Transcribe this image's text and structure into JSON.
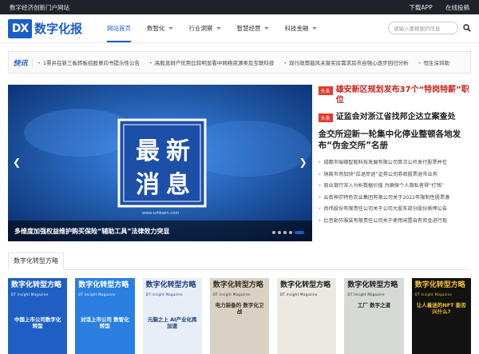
{
  "topbar": {
    "left": "数字经济创新门户网站",
    "download": "下载APP",
    "submit": "在线投稿"
  },
  "logo": {
    "mark": "DX",
    "text": "数字化报"
  },
  "nav": [
    {
      "label": "网站首页",
      "active": true
    },
    {
      "label": "数智化",
      "caret": true
    },
    {
      "label": "行业洞察",
      "caret": true
    },
    {
      "label": "智慧经营",
      "caret": true
    },
    {
      "label": "科技金融",
      "caret": true
    }
  ],
  "search": {
    "placeholder": "请输入要搜索的信息"
  },
  "ticker": {
    "label": "快讯",
    "items": [
      "1票并在新三板转板招股意向书提示性公告",
      "高股息财产优势比较明显看中网络资源类及互联科技",
      "现行政策鼓风关窗买房需求房市自强心逐步回归分析",
      "恒生深圳助"
    ]
  },
  "banner": {
    "big_chars": [
      "最",
      "新",
      "消",
      "息"
    ],
    "caption": "多维度加强权益维护购买保险“辅助工具”法律效力突显",
    "url_text": "www.szhbwm.com"
  },
  "side": {
    "headlines": [
      {
        "tag": "头条",
        "title": "雄安新区规划发布37个“特岗特薪”职位",
        "red": true
      },
      {
        "tag": "头条",
        "title": "证监会对浙江省找邦企达立案查处",
        "red": false
      }
    ],
    "big": "金交所迎新一轮集中化停业整顿各地发布“伪金交所”名册",
    "list": [
      "成都市瑞德智能科技发展有限公司首次公开发行股票并在",
      "钠离市场加快“应退尽退”证券公司券商股票退市业务",
      "商业银行深入分析数据价值 为确保个人隐私者得“打钱”",
      "云南神农特色农业集团有限公司关于2022年限制性股票激",
      "尚纬股份有限责任公司关于公司大股东部分股份质押公告",
      "比音勒芬服装有限责任公司关于使用闲置自有资金进行现"
    ]
  },
  "section": {
    "title": "数字化转型方略"
  },
  "covers": [
    {
      "title": "数字化转型方略",
      "sub": "DT Insight Magazine",
      "body": "中国上市公司数字化转型",
      "bg": "#1f5fc4",
      "fg": "#ffffff"
    },
    {
      "title": "数字化转型方略",
      "sub": "DT Insight Magazine",
      "body": "对话上市公司 数智化转型",
      "bg": "#2a7fe0",
      "fg": "#ffffff"
    },
    {
      "title": "数字化转型方略",
      "sub": "DT Insight Magazine",
      "body": "元脑之上 AI产业化再加速",
      "bg": "#e8eef7",
      "fg": "#1a3f7a"
    },
    {
      "title": "数字化转型方略",
      "sub": "DT Insight Magazine",
      "body": "电力装备的 数字化卫战",
      "bg": "#d8d2c4",
      "fg": "#3a3020"
    },
    {
      "title": "数字化转型方略",
      "sub": "DT Insight Magazine",
      "body": "",
      "bg": "#ece9e2",
      "fg": "#222222"
    },
    {
      "title": "数字化转型方略",
      "sub": "DT Insight Magazine",
      "body": "工厂 数字之道",
      "bg": "#d7d9d6",
      "fg": "#222222"
    },
    {
      "title": "数字化转型方略",
      "sub": "DT Insight Magazine",
      "body": "让人着迷的NFT 能否兴什么?",
      "bg": "#121212",
      "fg": "#f2c230"
    }
  ]
}
